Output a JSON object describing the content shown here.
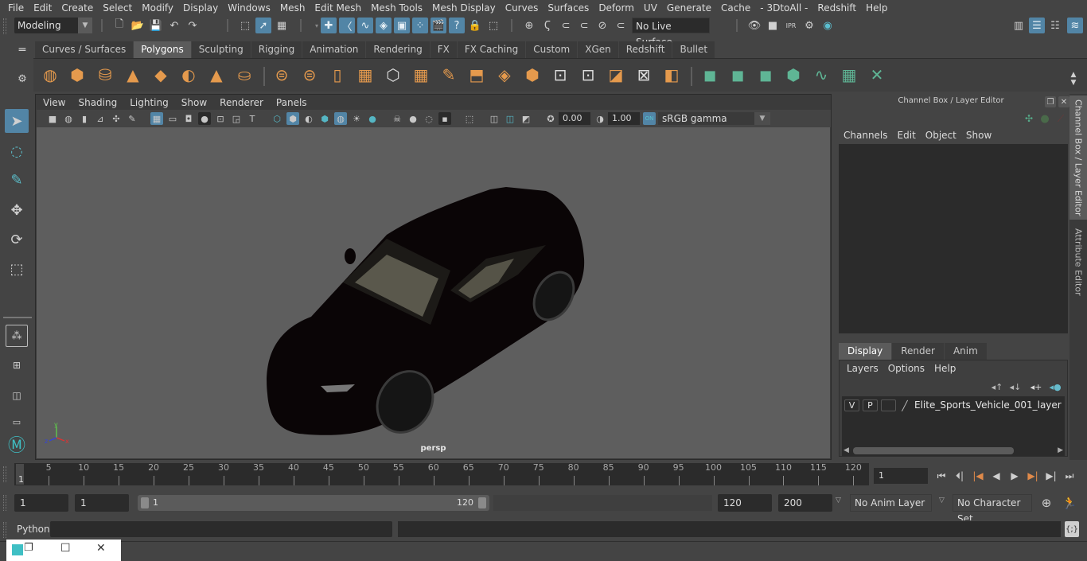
{
  "menubar": [
    "File",
    "Edit",
    "Create",
    "Select",
    "Modify",
    "Display",
    "Windows",
    "Mesh",
    "Edit Mesh",
    "Mesh Tools",
    "Mesh Display",
    "Curves",
    "Surfaces",
    "Deform",
    "UV",
    "Generate",
    "Cache",
    "- 3DtoAll -",
    "Redshift",
    "Help"
  ],
  "toolbar": {
    "mode": "Modeling",
    "live_surface": "No Live Surface"
  },
  "shelf": {
    "tabs": [
      "Curves / Surfaces",
      "Polygons",
      "Sculpting",
      "Rigging",
      "Animation",
      "Rendering",
      "FX",
      "FX Caching",
      "Custom",
      "XGen",
      "Redshift",
      "Bullet"
    ],
    "active_tab": "Polygons"
  },
  "viewport": {
    "menu": [
      "View",
      "Shading",
      "Lighting",
      "Show",
      "Renderer",
      "Panels"
    ],
    "exposure": "0.00",
    "gamma": "1.00",
    "color_mgmt_on": "ON",
    "color_space": "sRGB gamma",
    "camera_label": "persp",
    "axis": {
      "x": "x",
      "y": "y",
      "z": "z"
    }
  },
  "channel_box": {
    "title": "Channel Box / Layer Editor",
    "menu": [
      "Channels",
      "Edit",
      "Object",
      "Show"
    ]
  },
  "layer_editor": {
    "tabs": [
      "Display",
      "Render",
      "Anim"
    ],
    "active_tab": "Display",
    "menu": [
      "Layers",
      "Options",
      "Help"
    ],
    "layers": [
      {
        "v": "V",
        "p": "P",
        "name": "Elite_Sports_Vehicle_001_layer"
      }
    ]
  },
  "side_tabs": [
    "Channel Box / Layer Editor",
    "Attribute Editor"
  ],
  "timeline": {
    "ticks": [
      5,
      10,
      15,
      20,
      25,
      30,
      35,
      40,
      45,
      50,
      55,
      60,
      65,
      70,
      75,
      80,
      85,
      90,
      95,
      100,
      105,
      110,
      115,
      120
    ],
    "start_marker": "1",
    "current_frame": "1",
    "range_start": "1",
    "playback_start": "1",
    "slider_start": "1",
    "slider_end": "120",
    "playback_end": "120",
    "range_end": "200",
    "anim_layer": "No Anim Layer",
    "character_set": "No Character Set"
  },
  "command_line": {
    "language": "Python"
  }
}
